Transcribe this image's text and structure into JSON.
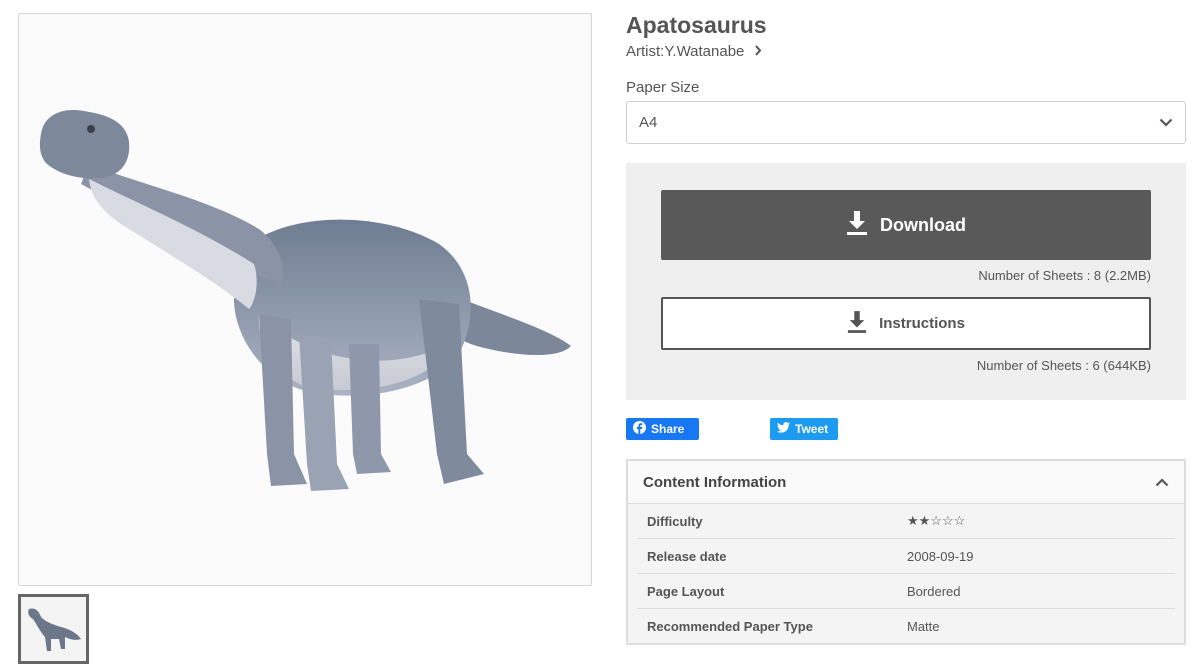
{
  "product": {
    "title": "Apatosaurus",
    "artist": "Artist:Y.Watanabe"
  },
  "paper_size": {
    "label": "Paper Size",
    "selected": "A4"
  },
  "download": {
    "download_label": "Download",
    "download_info": "Number of Sheets : 8 (2.2MB)",
    "instructions_label": "Instructions",
    "instructions_info": "Number of Sheets : 6 (644KB)"
  },
  "social": {
    "share_label": "Share",
    "tweet_label": "Tweet",
    "facebook_color": "#1877f2",
    "twitter_color": "#1d9bf0"
  },
  "content_info": {
    "heading": "Content Information",
    "rows": [
      {
        "key": "Difficulty",
        "value": "★★☆☆☆"
      },
      {
        "key": "Release date",
        "value": "2008-09-19"
      },
      {
        "key": "Page Layout",
        "value": "Bordered"
      },
      {
        "key": "Recommended Paper Type",
        "value": "Matte"
      }
    ]
  }
}
